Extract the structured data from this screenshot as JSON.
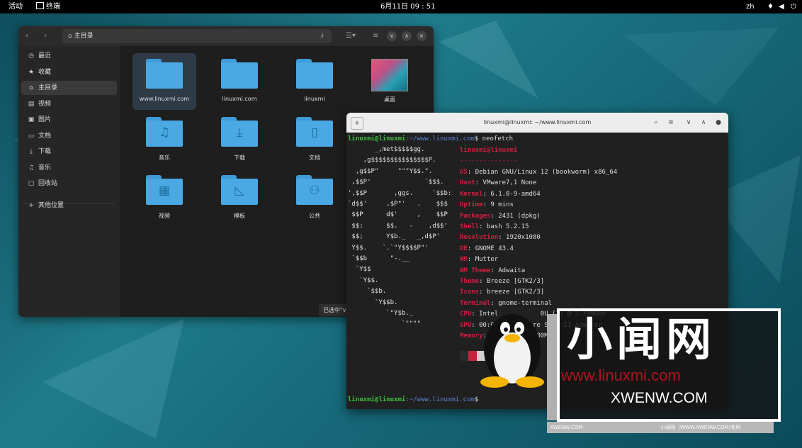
{
  "topbar": {
    "activities": "活动",
    "app_name": "终端",
    "clock": "6月11日 09 : 51",
    "lang": "zh"
  },
  "files": {
    "path_home": "主目录",
    "sidebar": [
      "最近",
      "收藏",
      "主目录",
      "视频",
      "图片",
      "文档",
      "下载",
      "音乐",
      "回收站",
      "其他位置"
    ],
    "folders": [
      {
        "name": "www.linuxmi.com",
        "icon": "folder"
      },
      {
        "name": "linuxmi.com",
        "icon": "folder"
      },
      {
        "name": "linuxmi",
        "icon": "folder"
      },
      {
        "name": "桌面",
        "icon": "wallpaper"
      },
      {
        "name": "音乐",
        "icon": "music-folder"
      },
      {
        "name": "下载",
        "icon": "download-folder"
      },
      {
        "name": "文档",
        "icon": "document-folder"
      },
      {
        "name": "视频",
        "icon": "video-folder"
      },
      {
        "name": "模板",
        "icon": "template-folder"
      },
      {
        "name": "公共",
        "icon": "public-folder"
      }
    ],
    "status": "已选中\"v"
  },
  "terminal": {
    "title": "linuxmi@linuxmi: ~/www.linuxmi.com",
    "prompt_user": "linuxmi@linuxmi",
    "prompt_path": ":~/www.linuxmi.com",
    "command": "$ neofetch",
    "logo": [
      "       _,met$$$$$gg.",
      "    ,g$$$$$$$$$$$$$$$P.",
      "  ,g$$P\"     \"\"\"Y$$.\".",
      " ,$$P'              `$$$.",
      "',$$P       ,ggs.     `$$b:",
      "`d$$'     ,$P\"'   .    $$$",
      " $$P      d$'     ,    $$P",
      " $$:      $$.   -    ,d$$'",
      " $$;      Y$b._   _,d$P'",
      " Y$$.    `.`\"Y$$$$P\"'",
      " `$$b      \"-.__",
      "  `Y$$",
      "   `Y$$.",
      "     `$$b.",
      "       `Y$$b.",
      "          `\"Y$b._",
      "              `\"\"\"\""
    ],
    "header": "linuxmi@linuxmi",
    "divider": "---------------",
    "info": [
      {
        "k": "OS",
        "v": "Debian GNU/Linux 12 (bookworm) x86_64"
      },
      {
        "k": "Host",
        "v": "VMware7,1 None"
      },
      {
        "k": "Kernel",
        "v": "6.1.0-9-amd64"
      },
      {
        "k": "Uptime",
        "v": "9 mins"
      },
      {
        "k": "Packages",
        "v": "2431 (dpkg)"
      },
      {
        "k": "Shell",
        "v": "bash 5.2.15"
      },
      {
        "k": "Resolution",
        "v": "1920x1080"
      },
      {
        "k": "DE",
        "v": "GNOME 43.4"
      },
      {
        "k": "WM",
        "v": "Mutter"
      },
      {
        "k": "WM Theme",
        "v": "Adwaita"
      },
      {
        "k": "Theme",
        "v": "Breeze [GTK2/3]"
      },
      {
        "k": "Icons",
        "v": "breeze [GTK2/3]"
      },
      {
        "k": "Terminal",
        "v": "gnome-terminal"
      },
      {
        "k": "CPU",
        "v": "Intel           0U (1) @ 2.799GHz"
      },
      {
        "k": "GPU",
        "v": "00:0f         re SVGA II Adapter"
      },
      {
        "k": "Memory",
        "v": "1         3880MiB"
      }
    ],
    "palette": [
      "#2a2a2a",
      "#c6233a",
      "#d0d0d0",
      "#888888",
      "#e05060",
      "#ffffff"
    ],
    "bottom_prompt": "$"
  },
  "watermark": {
    "big": "小闻网",
    "red": "www.linuxmi.com",
    "com": "XWENW.COM",
    "foot_left": "XWENW.COM",
    "foot_right": "小闻网（WWW.XWENW.COM)专用"
  }
}
